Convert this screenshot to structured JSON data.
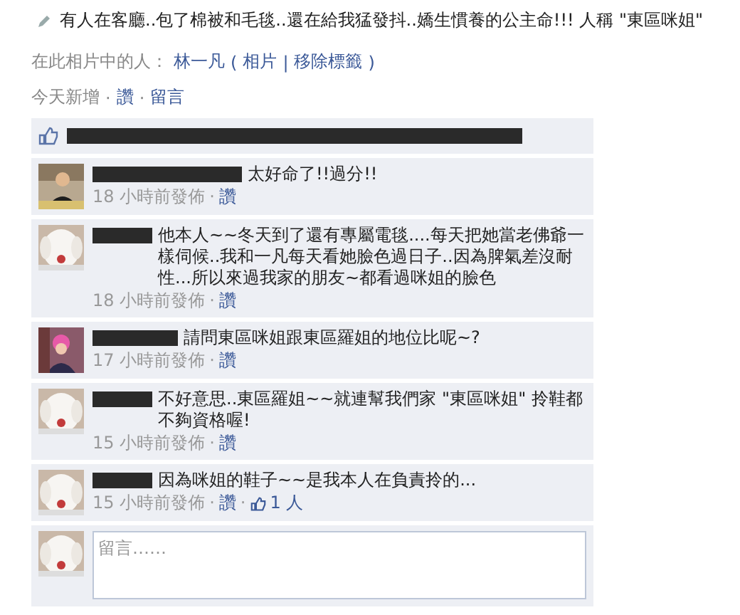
{
  "caption": "有人在客廳..包了棉被和毛毯..還在給我猛發抖..嬌生慣養的公主命!!! 人稱 \"東區咪姐\"",
  "tagged": {
    "label": "在此相片中的人：",
    "name": "林一凡",
    "open": "(",
    "photos": "相片",
    "separator": "|",
    "remove": "移除標籤",
    "close": ")"
  },
  "actions": {
    "time": "今天新增",
    "dot": "·",
    "like": "讚",
    "dot2": "·",
    "comment": "留言"
  },
  "comments": [
    {
      "text": "太好命了!!過分!!",
      "time": "18 小時前發佈",
      "dot": "·",
      "like": "讚"
    },
    {
      "text": "他本人~~冬天到了還有專屬電毯....每天把她當老佛爺一樣伺候..我和一凡每天看她臉色過日子..因為脾氣差沒耐性...所以來過我家的朋友~都看過咪姐的臉色",
      "time": "18 小時前發佈",
      "dot": "·",
      "like": "讚"
    },
    {
      "text": "請問東區咪姐跟東區羅姐的地位比呢~?",
      "time": "17 小時前發佈",
      "dot": "·",
      "like": "讚"
    },
    {
      "text": "不好意思..東區羅姐~~就連幫我們家 \"東區咪姐\" 拎鞋都不夠資格喔!",
      "time": "15 小時前發佈",
      "dot": "·",
      "like": "讚"
    },
    {
      "text": "因為咪姐的鞋子~~是我本人在負責拎的...",
      "time": "15 小時前發佈",
      "dot": "·",
      "like": "讚",
      "dot2": "·",
      "likes": "1 人"
    }
  ],
  "composer": {
    "placeholder": "留言……"
  }
}
